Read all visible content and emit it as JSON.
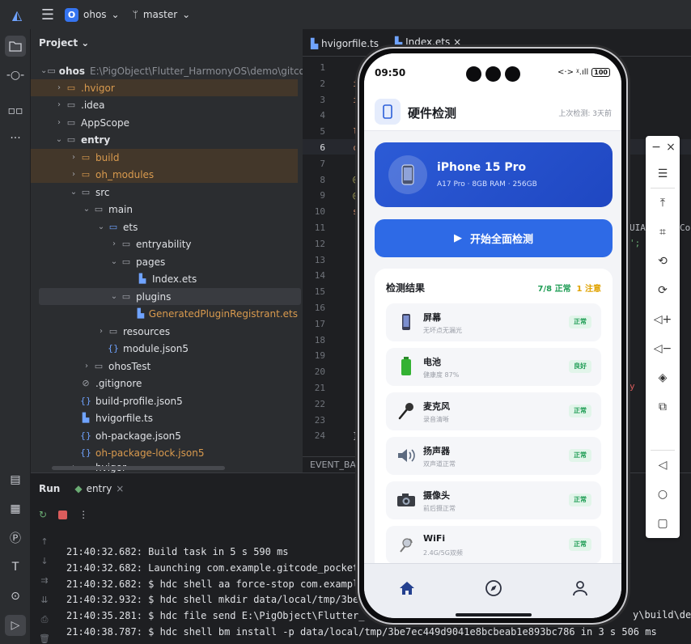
{
  "ide": {
    "project_name": "ohos",
    "branch": "master",
    "panel_title": "Project",
    "tree": [
      {
        "label": "ohos",
        "extra": "E:\\PigObject\\Flutter_HarmonyOS\\demo\\gitcode_p"
      },
      {
        "label": ".hvigor"
      },
      {
        "label": ".idea"
      },
      {
        "label": "AppScope"
      },
      {
        "label": "entry"
      },
      {
        "label": "build"
      },
      {
        "label": "oh_modules"
      },
      {
        "label": "src"
      },
      {
        "label": "main"
      },
      {
        "label": "ets"
      },
      {
        "label": "entryability"
      },
      {
        "label": "pages"
      },
      {
        "label": "Index.ets"
      },
      {
        "label": "plugins"
      },
      {
        "label": "GeneratedPluginRegistrant.ets"
      },
      {
        "label": "resources"
      },
      {
        "label": "module.json5"
      },
      {
        "label": "ohosTest"
      },
      {
        "label": ".gitignore"
      },
      {
        "label": "build-profile.json5"
      },
      {
        "label": "hvigorfile.ts"
      },
      {
        "label": "oh-package.json5"
      },
      {
        "label": "oh-package-lock.json5"
      },
      {
        "label": "hvigor"
      }
    ],
    "tabs": [
      "hvigorfile.ts",
      "Index.ets"
    ],
    "line_numbers": [
      "1",
      "2",
      "3",
      "4",
      "5",
      "6",
      "7",
      "8",
      "9",
      "10",
      "11",
      "12",
      "13",
      "14",
      "15",
      "16",
      "17",
      "18",
      "19",
      "20",
      "21",
      "22",
      "23",
      "24"
    ],
    "code_fragments": [
      "i",
      "i",
      "l",
      "c",
      "@",
      "@",
      "s",
      "}",
      "UIAb",
      "Co",
      "';",
      "y"
    ],
    "event_bar": "EVENT_BAC",
    "run": {
      "title": "Run",
      "tab": "entry",
      "log": [
        "21:40:32.682: Build task in 5 s 590 ms",
        "21:40:32.682: Launching com.example.gitcode_pocket",
        "21:40:32.682: $ hdc shell aa force-stop com.exampl",
        "21:40:32.932: $ hdc shell mkdir data/local/tmp/3be",
        "21:40:35.281: $ hdc file send E:\\PigObject\\Flutter_",
        "21:40:38.787: $ hdc shell bm install -p data/local/tmp/3be7ec449d9041e8bcbeab1e893bc786 in 3 s 506 ms"
      ],
      "log_tail": "y\\build\\defa"
    }
  },
  "phone": {
    "status_time": "09:50",
    "status_right": "<·> ᵡ.ıll",
    "battery": "100",
    "app_title": "硬件检测",
    "last_check": "上次检测: 3天前",
    "device_name": "iPhone 15 Pro",
    "device_spec": "A17 Pro · 8GB RAM · 256GB",
    "start_button": "开始全面检测",
    "results_title": "检测结果",
    "summary_ok": "7/8 正常",
    "summary_warn": "1 注意",
    "items": [
      {
        "icon": "phone-icon",
        "name": "屏幕",
        "sub": "无坏点无漏光",
        "status": "正常"
      },
      {
        "icon": "battery-icon",
        "name": "电池",
        "sub": "健康度 87%",
        "status": "良好"
      },
      {
        "icon": "microphone-icon",
        "name": "麦克风",
        "sub": "录音清晰",
        "status": "正常"
      },
      {
        "icon": "speaker-icon",
        "name": "扬声器",
        "sub": "双声道正常",
        "status": "正常"
      },
      {
        "icon": "camera-icon",
        "name": "摄像头",
        "sub": "前后摄正常",
        "status": "正常"
      },
      {
        "icon": "wifi-icon",
        "name": "WiFi",
        "sub": "2.4G/5G双频",
        "status": "正常"
      }
    ],
    "accent": "#2e6ae6"
  }
}
